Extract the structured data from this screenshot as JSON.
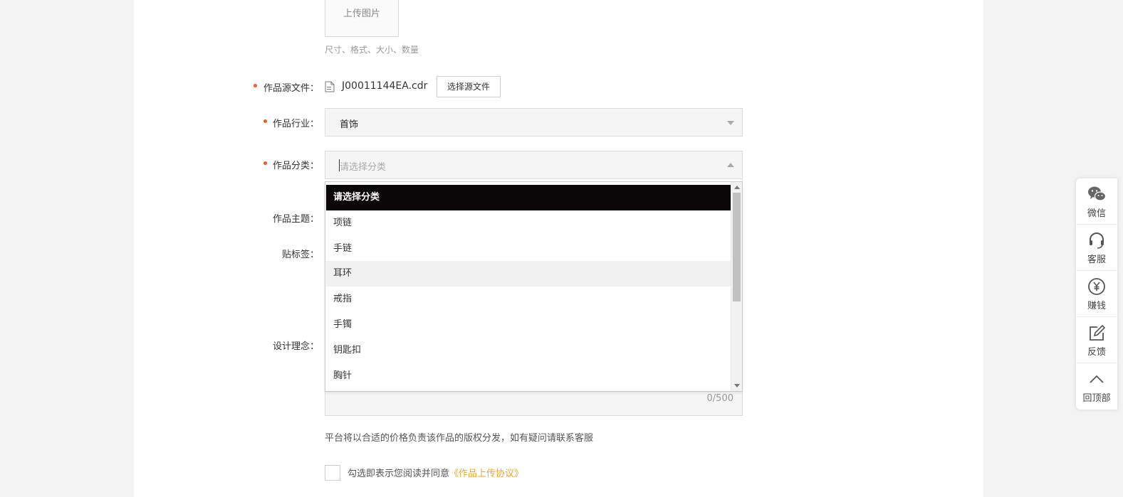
{
  "upload": {
    "button_label": "上传图片",
    "hint": "尺寸、格式、大小、数量"
  },
  "form": {
    "source_file": {
      "label": "作品源文件：",
      "file_name": "J00011144EA.cdr",
      "button_label": "选择源文件",
      "icon": "file-icon"
    },
    "industry": {
      "label": "作品行业：",
      "value": "首饰"
    },
    "category": {
      "label": "作品分类：",
      "placeholder": "请选择分类",
      "options": [
        "请选择分类",
        "项链",
        "手链",
        "耳环",
        "戒指",
        "手镯",
        "钥匙扣",
        "胸针"
      ],
      "selected_index": 0,
      "hover_index": 3
    },
    "theme": {
      "label": "作品主题："
    },
    "tags": {
      "label": "贴标签："
    },
    "concept": {
      "label": "设计理念：",
      "char_count": "0/500"
    },
    "notice": "平台将以合适的价格负责该作品的版权分发，如有疑问请联系客服",
    "agreement": {
      "text": "勾选即表示您阅读并同意",
      "link": "《作品上传协议》"
    }
  },
  "sidebar": {
    "items": [
      {
        "label": "微信",
        "icon": "wechat-icon"
      },
      {
        "label": "客服",
        "icon": "headset-icon"
      },
      {
        "label": "赚钱",
        "icon": "yen-icon"
      },
      {
        "label": "反馈",
        "icon": "edit-icon"
      },
      {
        "label": "回顶部",
        "icon": "chevron-up-icon"
      }
    ]
  },
  "colors": {
    "required_dot": "#f05a28",
    "selected_option_bg": "#0b0607",
    "link": "#f5a623"
  }
}
